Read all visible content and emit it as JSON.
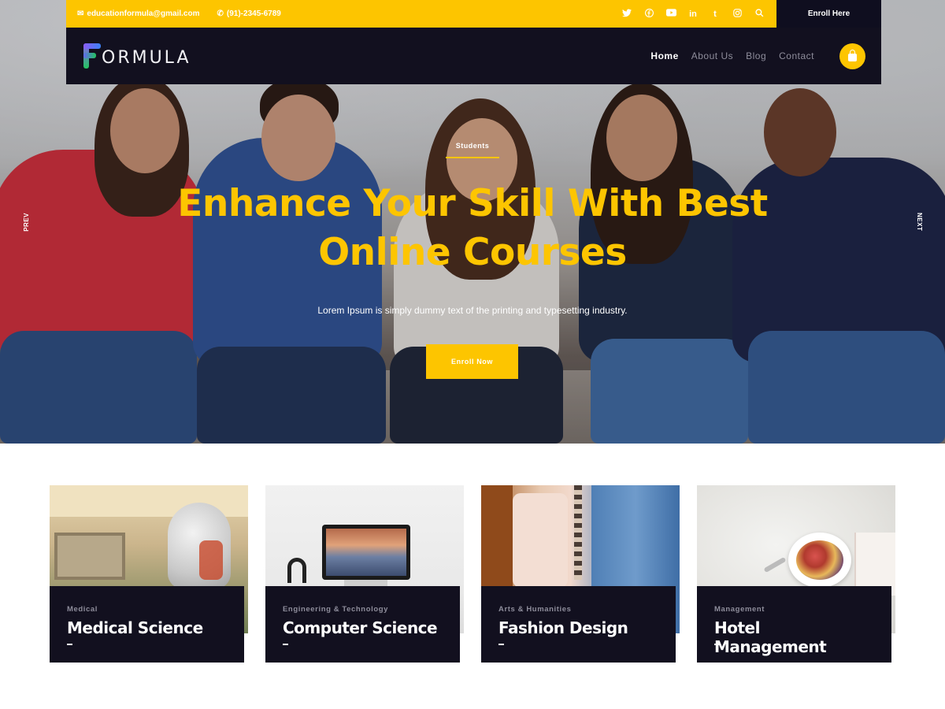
{
  "topbar": {
    "email": "educationformula@gmail.com",
    "phone": "(91)-2345-6789",
    "socials": [
      "twitter-icon",
      "facebook-icon",
      "youtube-icon",
      "linkedin-icon",
      "tumblr-icon",
      "instagram-icon",
      "search-icon"
    ],
    "enroll_here": "Enroll Here"
  },
  "nav": {
    "logo_text": "ORMULA",
    "links": [
      {
        "label": "Home",
        "active": true
      },
      {
        "label": "About Us",
        "active": false
      },
      {
        "label": "Blog",
        "active": false
      },
      {
        "label": "Contact",
        "active": false
      }
    ]
  },
  "hero": {
    "eyebrow": "Students",
    "headline_line1": "Enhance Your Skill With Best",
    "headline_line2": "Online Courses",
    "subtext": "Lorem Ipsum is simply dummy text of the printing and typesetting industry.",
    "cta": "Enroll Now",
    "prev": "PREV",
    "next": "NEXT"
  },
  "courses": [
    {
      "category": "Medical",
      "title": "Medical Science"
    },
    {
      "category": "Engineering & Technology",
      "title": "Computer Science"
    },
    {
      "category": "Arts & Humanities",
      "title": "Fashion Design"
    },
    {
      "category": "Management",
      "title": "Hotel Management"
    }
  ],
  "colors": {
    "accent": "#fdc500",
    "dark": "#12101f",
    "muted": "#8e8d9b"
  }
}
